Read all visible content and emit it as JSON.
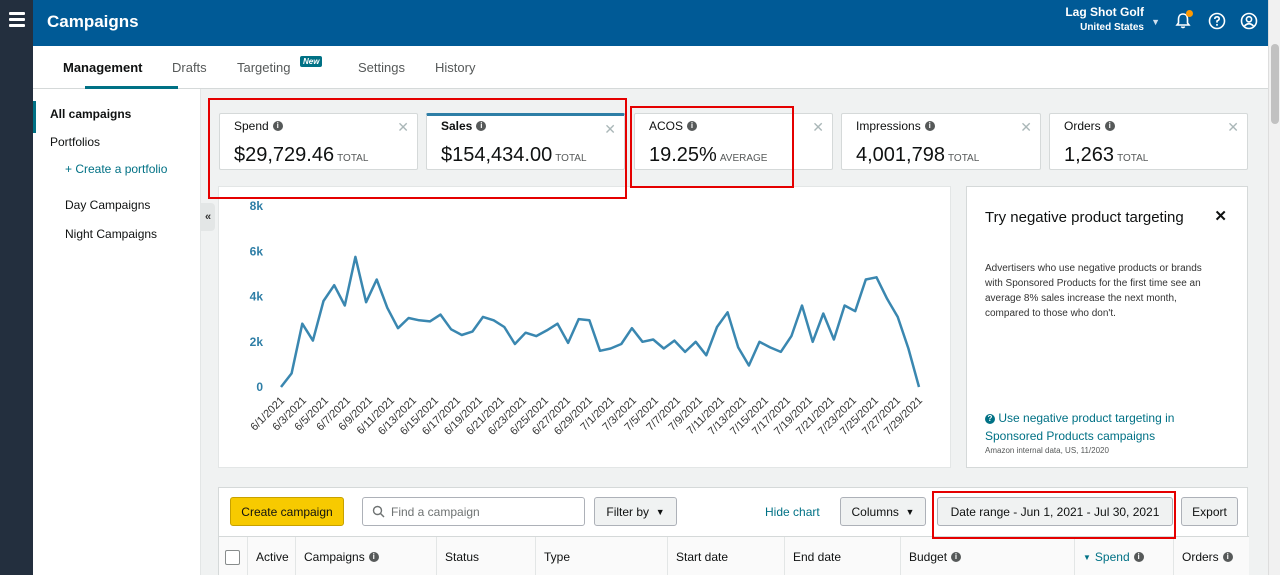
{
  "header": {
    "app_title": "Campaigns",
    "account_name": "Lag Shot Golf",
    "marketplace": "United States"
  },
  "tabs": [
    {
      "label": "Management",
      "active": true
    },
    {
      "label": "Drafts"
    },
    {
      "label": "Targeting",
      "badge": "New"
    },
    {
      "label": "Settings"
    },
    {
      "label": "History"
    }
  ],
  "sidebar": {
    "items": [
      {
        "label": "All campaigns"
      },
      {
        "label": "Portfolios"
      },
      {
        "label": "+ Create a portfolio"
      },
      {
        "label": "Day Campaigns"
      },
      {
        "label": "Night Campaigns"
      }
    ],
    "collapse_glyph": "«"
  },
  "metrics": [
    {
      "label": "Spend",
      "value": "$29,729.46",
      "suffix": "TOTAL"
    },
    {
      "label": "Sales",
      "value": "$154,434.00",
      "suffix": "TOTAL",
      "selected": true
    },
    {
      "label": "ACOS",
      "value": "19.25%",
      "suffix": "AVERAGE"
    },
    {
      "label": "Impressions",
      "value": "4,001,798",
      "suffix": "TOTAL"
    },
    {
      "label": "Orders",
      "value": "1,263",
      "suffix": "TOTAL"
    }
  ],
  "chart_data": {
    "type": "line",
    "title": "",
    "xlabel": "",
    "ylabel": "",
    "ylim": [
      0,
      8000
    ],
    "yticks": [
      0,
      2000,
      4000,
      6000,
      8000
    ],
    "ytick_labels": [
      "0",
      "2k",
      "4k",
      "6k",
      "8k"
    ],
    "xtick_labels": [
      "6/1/2021",
      "6/3/2021",
      "6/5/2021",
      "6/7/2021",
      "6/9/2021",
      "6/11/2021",
      "6/13/2021",
      "6/15/2021",
      "6/17/2021",
      "6/19/2021",
      "6/21/2021",
      "6/23/2021",
      "6/25/2021",
      "6/27/2021",
      "6/29/2021",
      "7/1/2021",
      "7/3/2021",
      "7/5/2021",
      "7/7/2021",
      "7/9/2021",
      "7/11/2021",
      "7/13/2021",
      "7/15/2021",
      "7/17/2021",
      "7/19/2021",
      "7/21/2021",
      "7/23/2021",
      "7/25/2021",
      "7/27/2021",
      "7/29/2021"
    ],
    "series_color": "#3a87b0",
    "series": [
      {
        "values": [
          0,
          600,
          2800,
          2050,
          3800,
          4500,
          3600,
          5750,
          3750,
          4750,
          3500,
          2600,
          3050,
          2950,
          2900,
          3200,
          2550,
          2300,
          2450,
          3100,
          2950,
          2650,
          1900,
          2400,
          2250,
          2500,
          2800,
          1950,
          3000,
          2950,
          1600,
          1700,
          1900,
          2600,
          2000,
          2100,
          1700,
          2050,
          1550,
          2000,
          1400,
          2650,
          3300,
          1750,
          950,
          2000,
          1750,
          1550,
          2250,
          3600,
          2000,
          3250,
          2100,
          3600,
          3350,
          4750,
          4850,
          3900,
          3100,
          1700,
          0
        ]
      }
    ]
  },
  "promo": {
    "title": "Try negative product targeting",
    "body": "Advertisers who use negative products or brands with Sponsored Products for the first time see an average 8% sales increase the next month, compared to those who don't.",
    "link": "Use negative product targeting in Sponsored Products campaigns",
    "link_icon": "?",
    "note": "Amazon internal data, US, 11/2020"
  },
  "toolbar": {
    "create_label": "Create campaign",
    "search_placeholder": "Find a campaign",
    "filter_label": "Filter by",
    "hide_chart_label": "Hide chart",
    "columns_label": "Columns",
    "date_range_label": "Date range - Jun 1, 2021 - Jul 30, 2021",
    "export_label": "Export"
  },
  "table": {
    "columns": [
      "Active",
      "Campaigns",
      "Status",
      "Type",
      "Start date",
      "End date",
      "Budget",
      "Spend",
      "Orders"
    ]
  },
  "colors": {
    "top_bar": "#005a96",
    "rail": "#232f3e",
    "accent": "#007185",
    "highlight_box": "#e50000",
    "primary_button": "#f7ca00"
  }
}
